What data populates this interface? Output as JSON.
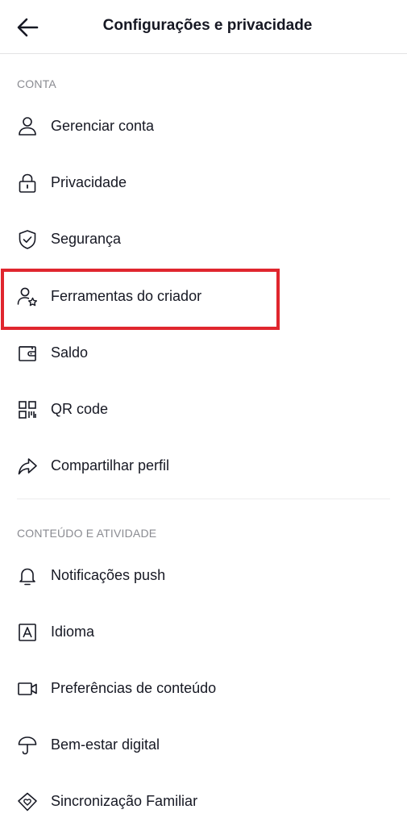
{
  "header": {
    "title": "Configurações e privacidade",
    "back_icon": "arrow-left-icon"
  },
  "sections": [
    {
      "title": "CONTA",
      "items": [
        {
          "label": "Gerenciar conta",
          "icon": "person-icon"
        },
        {
          "label": "Privacidade",
          "icon": "lock-icon"
        },
        {
          "label": "Segurança",
          "icon": "shield-check-icon"
        },
        {
          "label": "Ferramentas do criador",
          "icon": "person-star-icon",
          "highlighted": true
        },
        {
          "label": "Saldo",
          "icon": "wallet-icon"
        },
        {
          "label": "QR code",
          "icon": "qr-code-icon"
        },
        {
          "label": "Compartilhar perfil",
          "icon": "share-arrow-icon"
        }
      ]
    },
    {
      "title": "CONTEÚDO E ATIVIDADE",
      "items": [
        {
          "label": "Notificações push",
          "icon": "bell-icon"
        },
        {
          "label": "Idioma",
          "icon": "language-a-icon"
        },
        {
          "label": "Preferências de conteúdo",
          "icon": "video-camera-icon"
        },
        {
          "label": "Bem-estar digital",
          "icon": "umbrella-icon"
        },
        {
          "label": "Sincronização Familiar",
          "icon": "home-heart-icon"
        }
      ]
    }
  ],
  "colors": {
    "text": "#161823",
    "section_header": "#8a8b91",
    "icon": "#161823",
    "highlight": "#e0262e",
    "divider": "#ececed"
  }
}
